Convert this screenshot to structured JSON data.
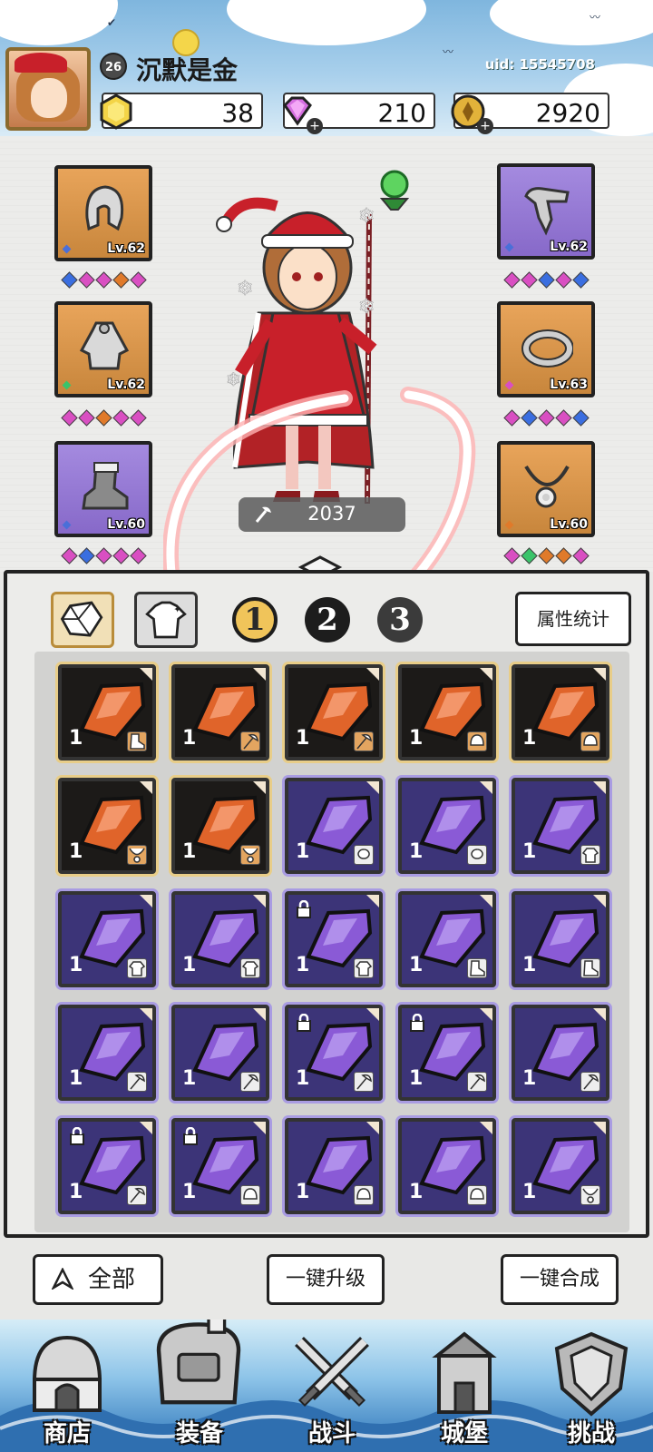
{
  "player": {
    "level": "26",
    "name": "沉默是金",
    "uid": "uid: 15545708"
  },
  "currencies": [
    {
      "name": "gold-crystal",
      "value": "38",
      "color": "#f3d447"
    },
    {
      "name": "diamond",
      "value": "210",
      "color": "#d56fe0"
    },
    {
      "name": "coin",
      "value": "2920",
      "color": "#e2b23a"
    }
  ],
  "equipment": {
    "left": [
      {
        "icon": "helmet-icon",
        "level": "Lv.62",
        "frame": "orange",
        "gems": [
          "#3a6ee0",
          "#d94fc2",
          "#d94fc2",
          "#e07a2a",
          "#d94fc2"
        ]
      },
      {
        "icon": "armor-icon",
        "level": "Lv.62",
        "frame": "orange",
        "gems": [
          "#d94fc2",
          "#d94fc2",
          "#e07a2a",
          "#d94fc2",
          "#d94fc2"
        ]
      },
      {
        "icon": "boots-icon",
        "level": "Lv.60",
        "frame": "purple",
        "gems": [
          "#d94fc2",
          "#3a6ee0",
          "#d94fc2",
          "#d94fc2",
          "#d94fc2"
        ]
      }
    ],
    "right": [
      {
        "icon": "gauntlet-icon",
        "level": "Lv.62",
        "frame": "purple",
        "gems": [
          "#d94fc2",
          "#d94fc2",
          "#3a6ee0",
          "#d94fc2",
          "#3a6ee0"
        ]
      },
      {
        "icon": "ring-icon",
        "level": "Lv.63",
        "frame": "orange",
        "gems": [
          "#d94fc2",
          "#3a6ee0",
          "#d94fc2",
          "#d94fc2",
          "#3a6ee0"
        ]
      },
      {
        "icon": "necklace-icon",
        "level": "Lv.60",
        "frame": "orange",
        "gems": [
          "#d94fc2",
          "#3ac46a",
          "#e07a2a",
          "#e07a2a",
          "#d94fc2"
        ]
      }
    ]
  },
  "power": {
    "icon": "weapon-icon",
    "value": "2037"
  },
  "tabs": {
    "gem_tab": "gem-tab-icon",
    "outfit_tab": "outfit-tab-icon",
    "pages": [
      "1",
      "2",
      "3"
    ],
    "selected_page": "1",
    "stats_button": "属性统计"
  },
  "inventory": [
    {
      "rarity": "orange",
      "qty": "1",
      "slot": "boots",
      "lock": false
    },
    {
      "rarity": "orange",
      "qty": "1",
      "slot": "weapon",
      "lock": false
    },
    {
      "rarity": "orange",
      "qty": "1",
      "slot": "weapon",
      "lock": false
    },
    {
      "rarity": "orange",
      "qty": "1",
      "slot": "helmet",
      "lock": false
    },
    {
      "rarity": "orange",
      "qty": "1",
      "slot": "helmet",
      "lock": false
    },
    {
      "rarity": "orange",
      "qty": "1",
      "slot": "necklace",
      "lock": false
    },
    {
      "rarity": "orange",
      "qty": "1",
      "slot": "necklace",
      "lock": false
    },
    {
      "rarity": "purple",
      "qty": "1",
      "slot": "ring",
      "lock": false
    },
    {
      "rarity": "purple",
      "qty": "1",
      "slot": "ring",
      "lock": false
    },
    {
      "rarity": "purple",
      "qty": "1",
      "slot": "armor",
      "lock": false
    },
    {
      "rarity": "purple",
      "qty": "1",
      "slot": "armor",
      "lock": false
    },
    {
      "rarity": "purple",
      "qty": "1",
      "slot": "armor",
      "lock": false
    },
    {
      "rarity": "purple",
      "qty": "1",
      "slot": "armor",
      "lock": true
    },
    {
      "rarity": "purple",
      "qty": "1",
      "slot": "boots",
      "lock": false
    },
    {
      "rarity": "purple",
      "qty": "1",
      "slot": "boots",
      "lock": false
    },
    {
      "rarity": "purple",
      "qty": "1",
      "slot": "weapon",
      "lock": false
    },
    {
      "rarity": "purple",
      "qty": "1",
      "slot": "weapon",
      "lock": false
    },
    {
      "rarity": "purple",
      "qty": "1",
      "slot": "weapon",
      "lock": true
    },
    {
      "rarity": "purple",
      "qty": "1",
      "slot": "weapon",
      "lock": true
    },
    {
      "rarity": "purple",
      "qty": "1",
      "slot": "weapon",
      "lock": false
    },
    {
      "rarity": "purple",
      "qty": "1",
      "slot": "weapon",
      "lock": true
    },
    {
      "rarity": "purple",
      "qty": "1",
      "slot": "helmet",
      "lock": true
    },
    {
      "rarity": "purple",
      "qty": "1",
      "slot": "helmet",
      "lock": false
    },
    {
      "rarity": "purple",
      "qty": "1",
      "slot": "helmet",
      "lock": false
    },
    {
      "rarity": "purple",
      "qty": "1",
      "slot": "necklace",
      "lock": false
    }
  ],
  "actions": {
    "all": "全部",
    "upgrade_all": "一键升级",
    "synthesize_all": "一键合成"
  },
  "nav": [
    {
      "label": "商店",
      "icon": "shop-icon"
    },
    {
      "label": "装备",
      "icon": "equipment-bag-icon"
    },
    {
      "label": "战斗",
      "icon": "crossed-swords-icon"
    },
    {
      "label": "城堡",
      "icon": "castle-icon"
    },
    {
      "label": "挑战",
      "icon": "challenge-shield-icon"
    }
  ],
  "colors": {
    "orange_rarity": "#e8cd88",
    "purple_rarity": "#a99ce2",
    "annotation": "#ff4a4a"
  }
}
